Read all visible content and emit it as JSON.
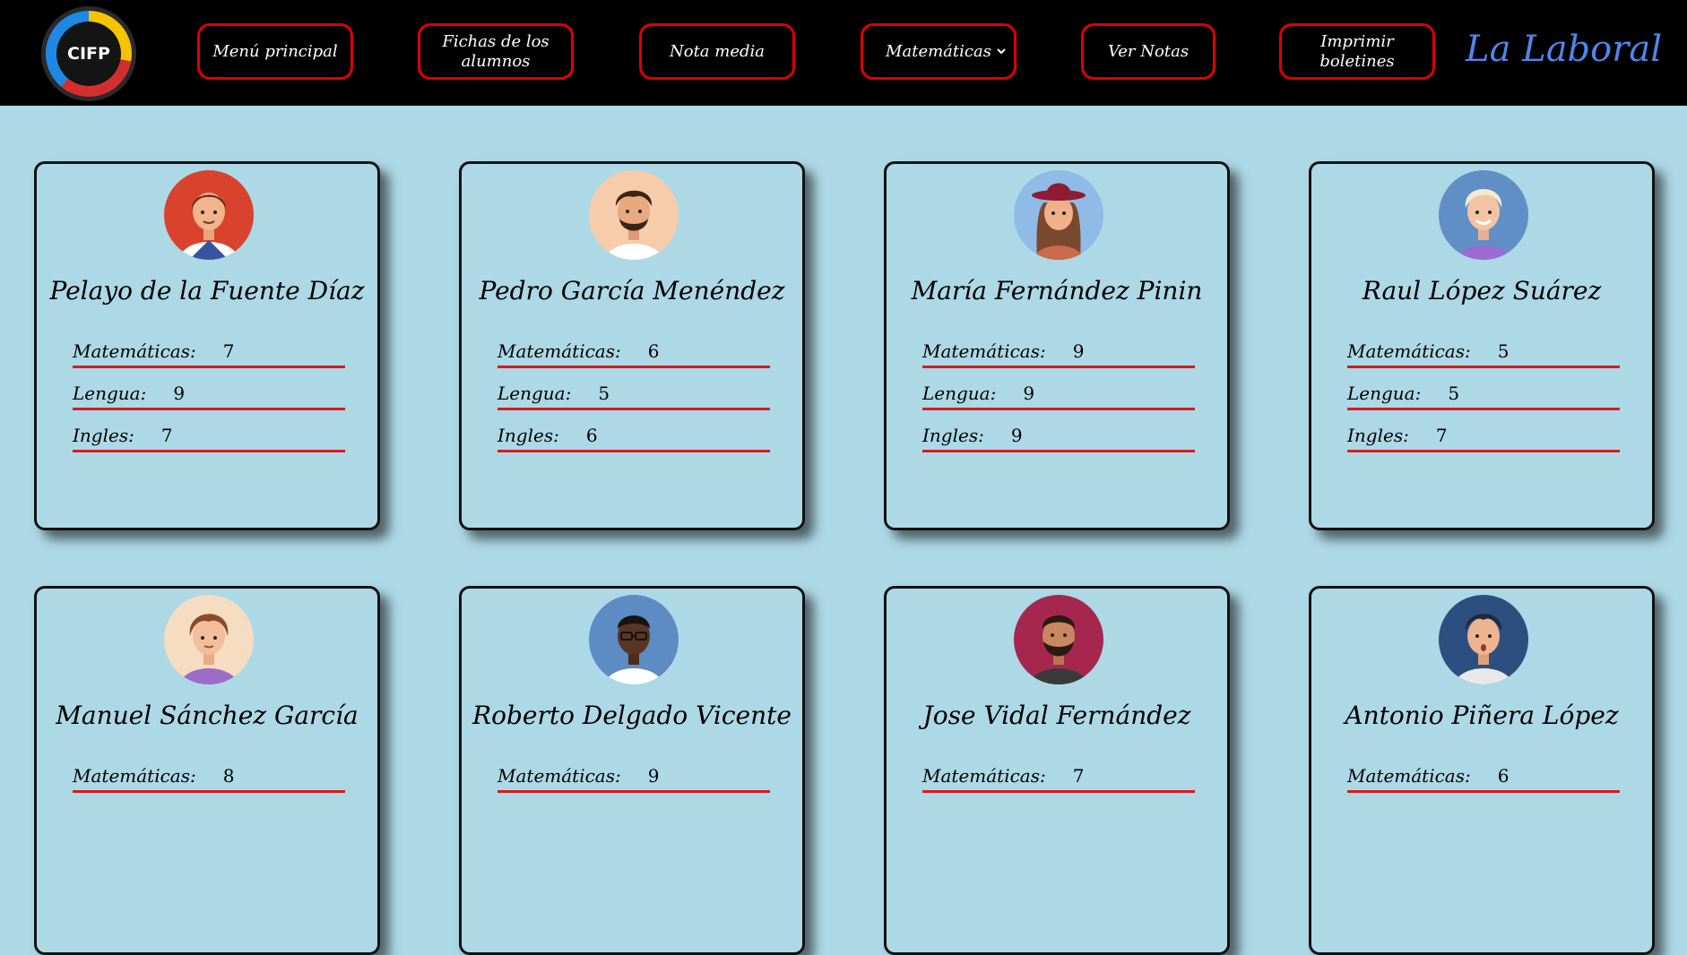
{
  "header": {
    "logo_text": "CIFP",
    "nav": [
      {
        "label": "Menú principal"
      },
      {
        "label": "Fichas de los alumnos"
      },
      {
        "label": "Nota media"
      },
      {
        "label": "Matemáticas"
      },
      {
        "label": "Ver Notas"
      },
      {
        "label": "Imprimir boletines"
      }
    ],
    "brand": "La Laboral"
  },
  "subject_labels": {
    "math": "Matemáticas:",
    "lang": "Lengua:",
    "eng": "Ingles:"
  },
  "students": [
    {
      "name": "Pelayo de la Fuente Díaz",
      "math": "7",
      "lang": "9",
      "eng": "7",
      "avatar_bg": "#d9432d"
    },
    {
      "name": "Pedro García Menéndez",
      "math": "6",
      "lang": "5",
      "eng": "6",
      "avatar_bg": "#f6ccaa"
    },
    {
      "name": "María Fernández Pinin",
      "math": "9",
      "lang": "9",
      "eng": "9",
      "avatar_bg": "#8fbbe6"
    },
    {
      "name": "Raul López Suárez",
      "math": "5",
      "lang": "5",
      "eng": "7",
      "avatar_bg": "#5f8fc4"
    },
    {
      "name": "Manuel Sánchez García",
      "math": "8",
      "avatar_bg": "#f6dcc0"
    },
    {
      "name": "Roberto Delgado Vicente",
      "math": "9",
      "avatar_bg": "#5d8bc4"
    },
    {
      "name": "Jose Vidal Fernández",
      "math": "7",
      "avatar_bg": "#a5274d"
    },
    {
      "name": "Antonio Piñera López",
      "math": "6",
      "avatar_bg": "#2c4f7f"
    }
  ],
  "colors": {
    "page_bg": "#add8e6",
    "topbar_bg": "#000000",
    "nav_border": "#e00000",
    "brand": "#4f86ec",
    "grade_underline": "#d81b1b"
  }
}
